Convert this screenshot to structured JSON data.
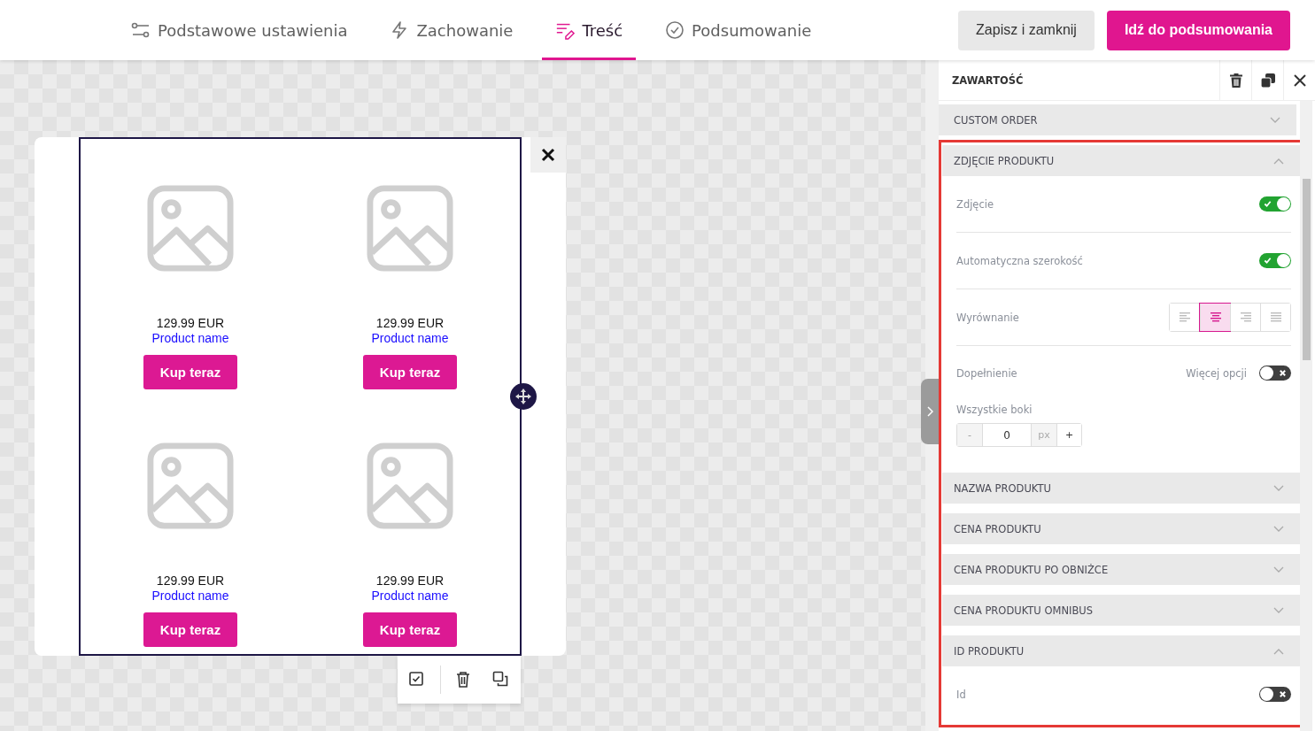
{
  "tabs": [
    {
      "label": "Podstawowe ustawienia",
      "selected": false
    },
    {
      "label": "Zachowanie",
      "selected": false
    },
    {
      "label": "Treść",
      "selected": true
    },
    {
      "label": "Podsumowanie",
      "selected": false
    }
  ],
  "actions": [
    {
      "label": "Zapisz i zamknij",
      "kind": "secondary"
    },
    {
      "label": "Idź do podsumowania",
      "kind": "primary"
    }
  ],
  "products": [
    {
      "price": "129.99 EUR",
      "name": "Product name",
      "button": "Kup teraz"
    },
    {
      "price": "129.99 EUR",
      "name": "Product name",
      "button": "Kup teraz"
    },
    {
      "price": "129.99 EUR",
      "name": "Product name",
      "button": "Kup teraz"
    },
    {
      "price": "129.99 EUR",
      "name": "Product name",
      "button": "Kup teraz"
    }
  ],
  "panel": {
    "title": "ZAWARTOŚĆ",
    "sections": [
      {
        "title": "CUSTOM ORDER",
        "expanded": false
      },
      {
        "title": "ZDJĘCIE PRODUKTU",
        "expanded": true,
        "settings": [
          {
            "kind": "toggle",
            "label": "Zdjęcie",
            "on": true
          },
          {
            "kind": "toggle",
            "label": "Automatyczna szerokość",
            "on": true
          },
          {
            "kind": "align",
            "label": "Wyrównanie",
            "options": [
              {
                "selected": false
              },
              {
                "selected": true
              },
              {
                "selected": false
              },
              {
                "selected": false
              }
            ]
          },
          {
            "kind": "padding",
            "label": "Dopełnienie",
            "more_label": "Więcej opcji",
            "more_on": false,
            "sublabel": "Wszystkie boki",
            "minus": "-",
            "value": "0",
            "unit": "px",
            "plus": "+"
          }
        ]
      },
      {
        "title": "NAZWA PRODUKTU",
        "expanded": false
      },
      {
        "title": "CENA PRODUKTU",
        "expanded": false
      },
      {
        "title": "CENA PRODUKTU PO OBNIŻCE",
        "expanded": false
      },
      {
        "title": "CENA PRODUKTU OMNIBUS",
        "expanded": false
      },
      {
        "title": "ID PRODUKTU",
        "expanded": true,
        "settings": [
          {
            "kind": "toggle",
            "label": "Id",
            "on": false
          }
        ]
      }
    ]
  }
}
